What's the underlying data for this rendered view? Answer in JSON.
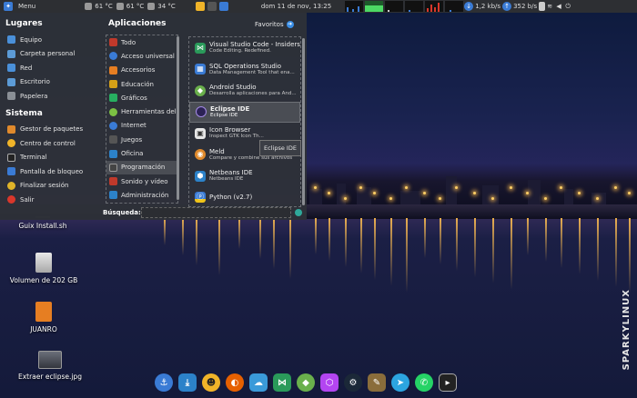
{
  "top_panel": {
    "menu_label": "Menu",
    "temps": [
      "61 °C",
      "61 °C",
      "34 °C"
    ],
    "datetime": "dom 11 de nov, 13:25",
    "net_down": "1,2 kb/s",
    "net_up": "352 b/s"
  },
  "menu": {
    "places_title": "Lugares",
    "places": [
      {
        "label": "Equipo",
        "icon": "computer-icon",
        "color": "#4a90d9"
      },
      {
        "label": "Carpeta personal",
        "icon": "home-folder-icon",
        "color": "#5c9bd6"
      },
      {
        "label": "Red",
        "icon": "network-icon",
        "color": "#4a90d9"
      },
      {
        "label": "Escritorio",
        "icon": "desktop-folder-icon",
        "color": "#5c9bd6"
      },
      {
        "label": "Papelera",
        "icon": "trash-icon",
        "color": "#8a8f96"
      }
    ],
    "system_title": "Sistema",
    "system": [
      {
        "label": "Gestor de paquetes",
        "icon": "package-manager-icon",
        "color": "#e08a2c"
      },
      {
        "label": "Centro de control",
        "icon": "control-center-icon",
        "color": "#f0b429"
      },
      {
        "label": "Terminal",
        "icon": "terminal-icon",
        "color": "#222"
      },
      {
        "label": "Pantalla de bloqueo",
        "icon": "lock-screen-icon",
        "color": "#3a7bd5"
      },
      {
        "label": "Finalizar sesión",
        "icon": "logout-icon",
        "color": "#e0b429"
      },
      {
        "label": "Salir",
        "icon": "power-icon",
        "color": "#d9372b"
      }
    ],
    "apps_title": "Aplicaciones",
    "favorites_label": "Favoritos",
    "categories": [
      {
        "label": "Todo",
        "icon": "all-apps-icon",
        "color": "#c0392b"
      },
      {
        "label": "Acceso universal",
        "icon": "accessibility-icon",
        "color": "#3a7bd5"
      },
      {
        "label": "Accesorios",
        "icon": "accessories-icon",
        "color": "#e67e22"
      },
      {
        "label": "Educación",
        "icon": "education-icon",
        "color": "#d4a017"
      },
      {
        "label": "Gráficos",
        "icon": "graphics-icon",
        "color": "#27ae60"
      },
      {
        "label": "Herramientas del.",
        "icon": "tools-icon",
        "color": "#7bc043"
      },
      {
        "label": "Internet",
        "icon": "internet-icon",
        "color": "#3a7bd5"
      },
      {
        "label": "Juegos",
        "icon": "games-icon",
        "color": "#555"
      },
      {
        "label": "Oficina",
        "icon": "office-icon",
        "color": "#2c82c9"
      },
      {
        "label": "Programación",
        "icon": "programming-icon",
        "color": "#444"
      },
      {
        "label": "Sonido y vídeo",
        "icon": "multimedia-icon",
        "color": "#c0392b"
      },
      {
        "label": "Administración",
        "icon": "administration-icon",
        "color": "#2c82c9"
      }
    ],
    "apps": [
      {
        "name": "Visual Studio Code - Insiders",
        "desc": "Code Editing. Redefined.",
        "icon": "vscode-icon",
        "color": "#2a9a5a"
      },
      {
        "name": "SQL Operations Studio",
        "desc": "Data Management Tool that ena...",
        "icon": "sql-studio-icon",
        "color": "#3a7bd5"
      },
      {
        "name": "Android Studio",
        "desc": "Desarrolla aplicaciones para And...",
        "icon": "android-studio-icon",
        "color": "#6ab04c"
      },
      {
        "name": "Eclipse IDE",
        "desc": "Eclipse IDE",
        "icon": "eclipse-icon",
        "color": "#2c2255"
      },
      {
        "name": "Icon Browser",
        "desc": "Inspect GTK Icon Th...",
        "icon": "icon-browser-icon",
        "color": "#e6e6e6"
      },
      {
        "name": "Meld",
        "desc": "Compare y combine sus archivos",
        "icon": "meld-icon",
        "color": "#e08a2c"
      },
      {
        "name": "Netbeans IDE",
        "desc": "Netbeans IDE",
        "icon": "netbeans-icon",
        "color": "#2c82c9"
      },
      {
        "name": "Python (v2.7)",
        "desc": "",
        "icon": "python-icon",
        "color": "#3a7bd5"
      }
    ],
    "tooltip": "Eclipse IDE",
    "search_label": "Búsqueda:",
    "search_value": ""
  },
  "desktop": {
    "icons": [
      {
        "label": "Guix Install.sh",
        "icon": "script-file-icon"
      },
      {
        "label": "Volumen de 202 GB",
        "icon": "drive-icon"
      },
      {
        "label": "JUANRO",
        "icon": "usb-drive-icon"
      },
      {
        "label": "Extraer eclipse.jpg",
        "icon": "image-file-icon"
      }
    ],
    "brand": "SPARKYLINUX"
  },
  "dock": [
    {
      "icon": "anchor-icon",
      "color": "#3a7bd5"
    },
    {
      "icon": "downloads-icon",
      "color": "#2c82c9"
    },
    {
      "icon": "penguin-icon",
      "color": "#f0b429"
    },
    {
      "icon": "firefox-icon",
      "color": "#e66000"
    },
    {
      "icon": "cloud-sync-icon",
      "color": "#3a9ad9"
    },
    {
      "icon": "vscode-icon",
      "color": "#2a9a5a"
    },
    {
      "icon": "android-studio-icon",
      "color": "#6ab04c"
    },
    {
      "icon": "phpstorm-icon",
      "color": "#b345f1"
    },
    {
      "icon": "steam-icon",
      "color": "#1b2838"
    },
    {
      "icon": "gimp-icon",
      "color": "#8a6d3b"
    },
    {
      "icon": "telegram-icon",
      "color": "#2ca5e0"
    },
    {
      "icon": "whatsapp-icon",
      "color": "#25d366"
    },
    {
      "icon": "terminal-icon",
      "color": "#222"
    }
  ]
}
